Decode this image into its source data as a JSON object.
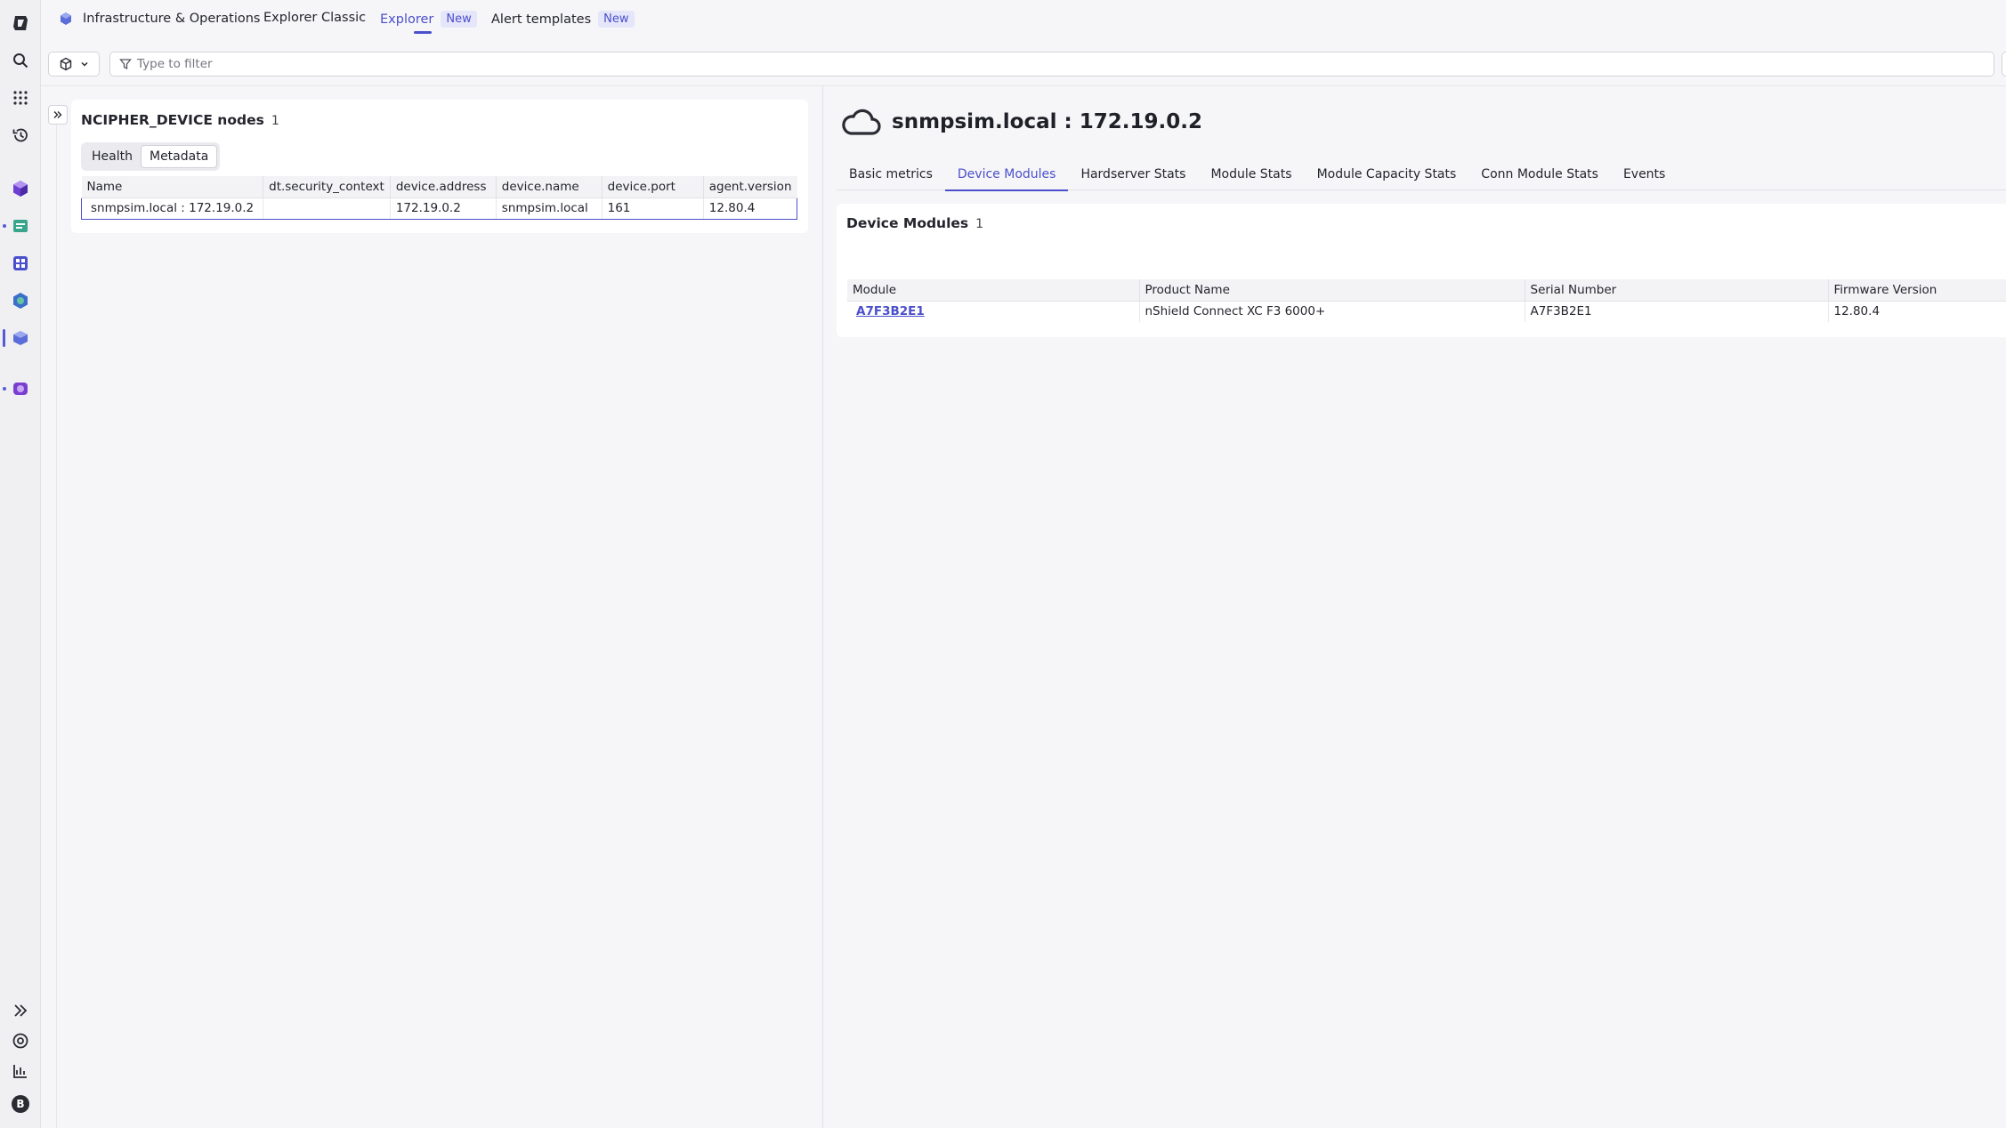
{
  "rail": {
    "items": [
      "dynatrace-logo",
      "search",
      "apps",
      "recent",
      "infrastructure",
      "notebooks",
      "dashboards",
      "kubernetes",
      "infrastructure-operations",
      "workflows"
    ],
    "bottom": [
      "expand",
      "help",
      "analytics",
      "user"
    ],
    "user_initial": "B"
  },
  "header": {
    "app_title": "Infrastructure & Operations",
    "tabs": [
      {
        "label": "Explorer Classic",
        "badge": ""
      },
      {
        "label": "Explorer",
        "badge": "New",
        "active": true
      },
      {
        "label": "Alert templates",
        "badge": "New"
      }
    ]
  },
  "filter": {
    "placeholder": "Type to filter"
  },
  "left_panel": {
    "title": "NCIPHER_DEVICE nodes",
    "count": "1",
    "segments": [
      "Health",
      "Metadata"
    ],
    "selected_segment": "Metadata",
    "columns": [
      "Name",
      "dt.security_context",
      "device.address",
      "device.name",
      "device.port",
      "agent.version"
    ],
    "rows": [
      [
        "snmpsim.local : 172.19.0.2",
        "",
        "172.19.0.2",
        "snmpsim.local",
        "161",
        "12.80.4"
      ]
    ]
  },
  "detail": {
    "title": "snmpsim.local : 172.19.0.2",
    "tabs": [
      "Basic metrics",
      "Device Modules",
      "Hardserver Stats",
      "Module Stats",
      "Module Capacity Stats",
      "Conn Module Stats",
      "Events"
    ],
    "active_tab": "Device Modules",
    "section_title": "Device Modules",
    "section_count": "1",
    "columns": [
      "Module",
      "Product Name",
      "Serial Number",
      "Firmware Version"
    ],
    "rows": [
      [
        "A7F3B2E1",
        "nShield Connect XC F3 6000+",
        "A7F3B2E1",
        "12.80.4"
      ]
    ]
  },
  "colors": {
    "accent": "#4b4fcb",
    "background": "#f6f6f8"
  }
}
